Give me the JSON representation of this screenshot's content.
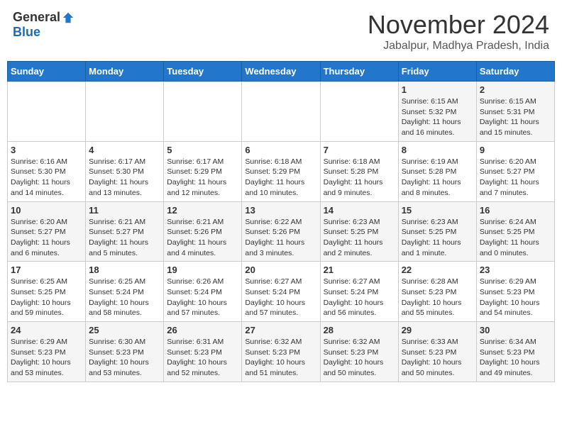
{
  "logo": {
    "general": "General",
    "blue": "Blue"
  },
  "title": "November 2024",
  "subtitle": "Jabalpur, Madhya Pradesh, India",
  "headers": [
    "Sunday",
    "Monday",
    "Tuesday",
    "Wednesday",
    "Thursday",
    "Friday",
    "Saturday"
  ],
  "weeks": [
    [
      {
        "day": "",
        "info": ""
      },
      {
        "day": "",
        "info": ""
      },
      {
        "day": "",
        "info": ""
      },
      {
        "day": "",
        "info": ""
      },
      {
        "day": "",
        "info": ""
      },
      {
        "day": "1",
        "info": "Sunrise: 6:15 AM\nSunset: 5:32 PM\nDaylight: 11 hours and 16 minutes."
      },
      {
        "day": "2",
        "info": "Sunrise: 6:15 AM\nSunset: 5:31 PM\nDaylight: 11 hours and 15 minutes."
      }
    ],
    [
      {
        "day": "3",
        "info": "Sunrise: 6:16 AM\nSunset: 5:30 PM\nDaylight: 11 hours and 14 minutes."
      },
      {
        "day": "4",
        "info": "Sunrise: 6:17 AM\nSunset: 5:30 PM\nDaylight: 11 hours and 13 minutes."
      },
      {
        "day": "5",
        "info": "Sunrise: 6:17 AM\nSunset: 5:29 PM\nDaylight: 11 hours and 12 minutes."
      },
      {
        "day": "6",
        "info": "Sunrise: 6:18 AM\nSunset: 5:29 PM\nDaylight: 11 hours and 10 minutes."
      },
      {
        "day": "7",
        "info": "Sunrise: 6:18 AM\nSunset: 5:28 PM\nDaylight: 11 hours and 9 minutes."
      },
      {
        "day": "8",
        "info": "Sunrise: 6:19 AM\nSunset: 5:28 PM\nDaylight: 11 hours and 8 minutes."
      },
      {
        "day": "9",
        "info": "Sunrise: 6:20 AM\nSunset: 5:27 PM\nDaylight: 11 hours and 7 minutes."
      }
    ],
    [
      {
        "day": "10",
        "info": "Sunrise: 6:20 AM\nSunset: 5:27 PM\nDaylight: 11 hours and 6 minutes."
      },
      {
        "day": "11",
        "info": "Sunrise: 6:21 AM\nSunset: 5:27 PM\nDaylight: 11 hours and 5 minutes."
      },
      {
        "day": "12",
        "info": "Sunrise: 6:21 AM\nSunset: 5:26 PM\nDaylight: 11 hours and 4 minutes."
      },
      {
        "day": "13",
        "info": "Sunrise: 6:22 AM\nSunset: 5:26 PM\nDaylight: 11 hours and 3 minutes."
      },
      {
        "day": "14",
        "info": "Sunrise: 6:23 AM\nSunset: 5:25 PM\nDaylight: 11 hours and 2 minutes."
      },
      {
        "day": "15",
        "info": "Sunrise: 6:23 AM\nSunset: 5:25 PM\nDaylight: 11 hours and 1 minute."
      },
      {
        "day": "16",
        "info": "Sunrise: 6:24 AM\nSunset: 5:25 PM\nDaylight: 11 hours and 0 minutes."
      }
    ],
    [
      {
        "day": "17",
        "info": "Sunrise: 6:25 AM\nSunset: 5:25 PM\nDaylight: 10 hours and 59 minutes."
      },
      {
        "day": "18",
        "info": "Sunrise: 6:25 AM\nSunset: 5:24 PM\nDaylight: 10 hours and 58 minutes."
      },
      {
        "day": "19",
        "info": "Sunrise: 6:26 AM\nSunset: 5:24 PM\nDaylight: 10 hours and 57 minutes."
      },
      {
        "day": "20",
        "info": "Sunrise: 6:27 AM\nSunset: 5:24 PM\nDaylight: 10 hours and 57 minutes."
      },
      {
        "day": "21",
        "info": "Sunrise: 6:27 AM\nSunset: 5:24 PM\nDaylight: 10 hours and 56 minutes."
      },
      {
        "day": "22",
        "info": "Sunrise: 6:28 AM\nSunset: 5:23 PM\nDaylight: 10 hours and 55 minutes."
      },
      {
        "day": "23",
        "info": "Sunrise: 6:29 AM\nSunset: 5:23 PM\nDaylight: 10 hours and 54 minutes."
      }
    ],
    [
      {
        "day": "24",
        "info": "Sunrise: 6:29 AM\nSunset: 5:23 PM\nDaylight: 10 hours and 53 minutes."
      },
      {
        "day": "25",
        "info": "Sunrise: 6:30 AM\nSunset: 5:23 PM\nDaylight: 10 hours and 53 minutes."
      },
      {
        "day": "26",
        "info": "Sunrise: 6:31 AM\nSunset: 5:23 PM\nDaylight: 10 hours and 52 minutes."
      },
      {
        "day": "27",
        "info": "Sunrise: 6:32 AM\nSunset: 5:23 PM\nDaylight: 10 hours and 51 minutes."
      },
      {
        "day": "28",
        "info": "Sunrise: 6:32 AM\nSunset: 5:23 PM\nDaylight: 10 hours and 50 minutes."
      },
      {
        "day": "29",
        "info": "Sunrise: 6:33 AM\nSunset: 5:23 PM\nDaylight: 10 hours and 50 minutes."
      },
      {
        "day": "30",
        "info": "Sunrise: 6:34 AM\nSunset: 5:23 PM\nDaylight: 10 hours and 49 minutes."
      }
    ]
  ]
}
